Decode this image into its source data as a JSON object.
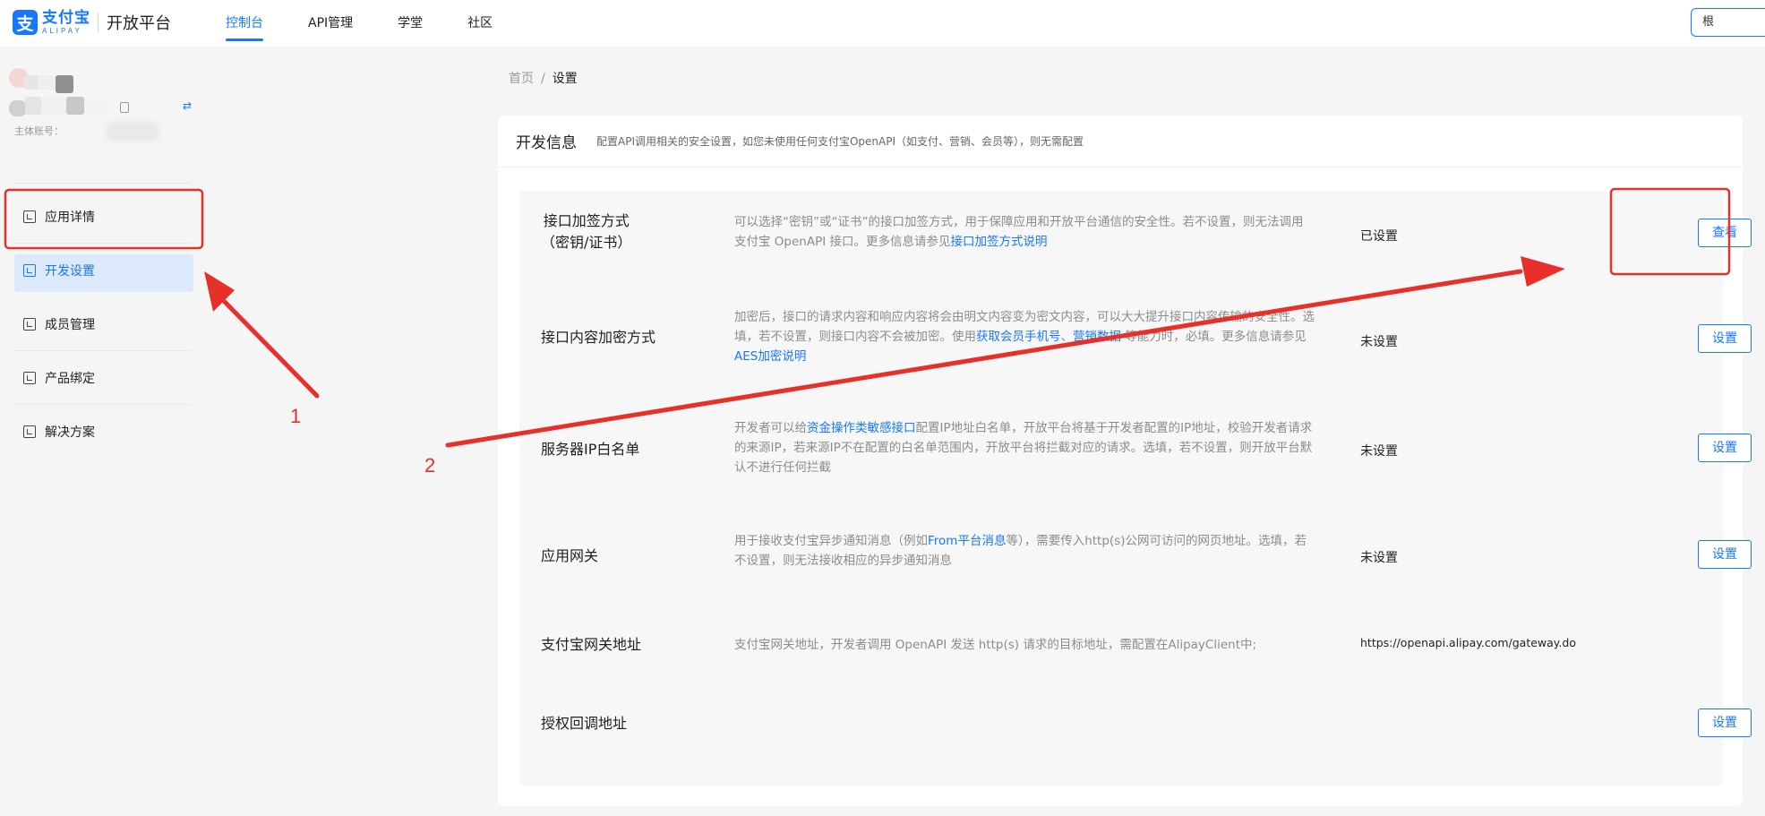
{
  "header": {
    "logo_cn": "支付宝",
    "logo_en": "ALIPAY",
    "platform": "开放平台",
    "nav": [
      "控制台",
      "API管理",
      "学堂",
      "社区"
    ],
    "active_nav": "控制台",
    "search_text": "根"
  },
  "sidebar": {
    "account_label": "主体账号：",
    "menu": [
      {
        "label": "应用详情",
        "icon": "chart-icon"
      },
      {
        "label": "开发设置",
        "icon": "settings-icon"
      },
      {
        "label": "成员管理",
        "icon": "members-icon"
      },
      {
        "label": "产品绑定",
        "icon": "product-icon"
      },
      {
        "label": "解决方案",
        "icon": "solution-icon"
      }
    ],
    "active_menu": "开发设置"
  },
  "breadcrumb": {
    "home": "首页",
    "sep": "/",
    "current": "设置"
  },
  "card": {
    "title": "开发信息",
    "desc": "配置API调用相关的安全设置，如您未使用任何支付宝OpenAPI（如支付、营销、会员等），则无需配置"
  },
  "rows": [
    {
      "name_line1": "接口加签方式",
      "name_line2": "（密钥/证书）",
      "desc_text": "可以选择“密钥”或“证书”的接口加签方式，用于保障应用和开放平台通信的安全性。若不设置，则无法调用支付宝 OpenAPI 接口。更多信息请参见",
      "desc_link": "接口加签方式说明",
      "status": "已设置",
      "button": "查看"
    },
    {
      "name_line1": "接口内容加密方式",
      "desc_text": "加密后，接口的请求内容和响应内容将会由明文内容变为密文内容，可以大大提升接口内容传输的安全性。选填，若不设置，则接口内容不会被加密。使用",
      "desc_link": "获取会员手机号",
      "desc_text2": "、",
      "desc_link2": "营销数据",
      "desc_text3": " 等能力时，必填。更多信息请参见",
      "desc_link3": "AES加密说明",
      "status": "未设置",
      "button": "设置"
    },
    {
      "name_line1": "服务器IP白名单",
      "desc_text": "开发者可以给",
      "desc_link": "资金操作类敏感接口",
      "desc_text2": "配置IP地址白名单，开放平台将基于开发者配置的IP地址，校验开发者请求的来源IP，若来源IP不在配置的白名单范围内，开放平台将拦截对应的请求。选填，若不设置，则开放平台默认不进行任何拦截",
      "status": "未设置",
      "button": "设置"
    },
    {
      "name_line1": "应用网关",
      "desc_text": "用于接收支付宝异步通知消息（例如",
      "desc_link": "From平台消息",
      "desc_text2": "等），需要传入http(s)公网可访问的网页地址。选填，若不设置，则无法接收相应的异步通知消息",
      "status": "未设置",
      "button": "设置"
    },
    {
      "name_line1": "支付宝网关地址",
      "desc_text": "支付宝网关地址，开发者调用 OpenAPI 发送 http(s) 请求的目标地址，需配置在AlipayClient中;",
      "status": "https://openapi.alipay.com/gateway.do"
    },
    {
      "name_line1": "授权回调地址",
      "button": "设置"
    }
  ],
  "annotations": {
    "label_1": "1",
    "label_2": "2",
    "color": "#e8302a"
  }
}
